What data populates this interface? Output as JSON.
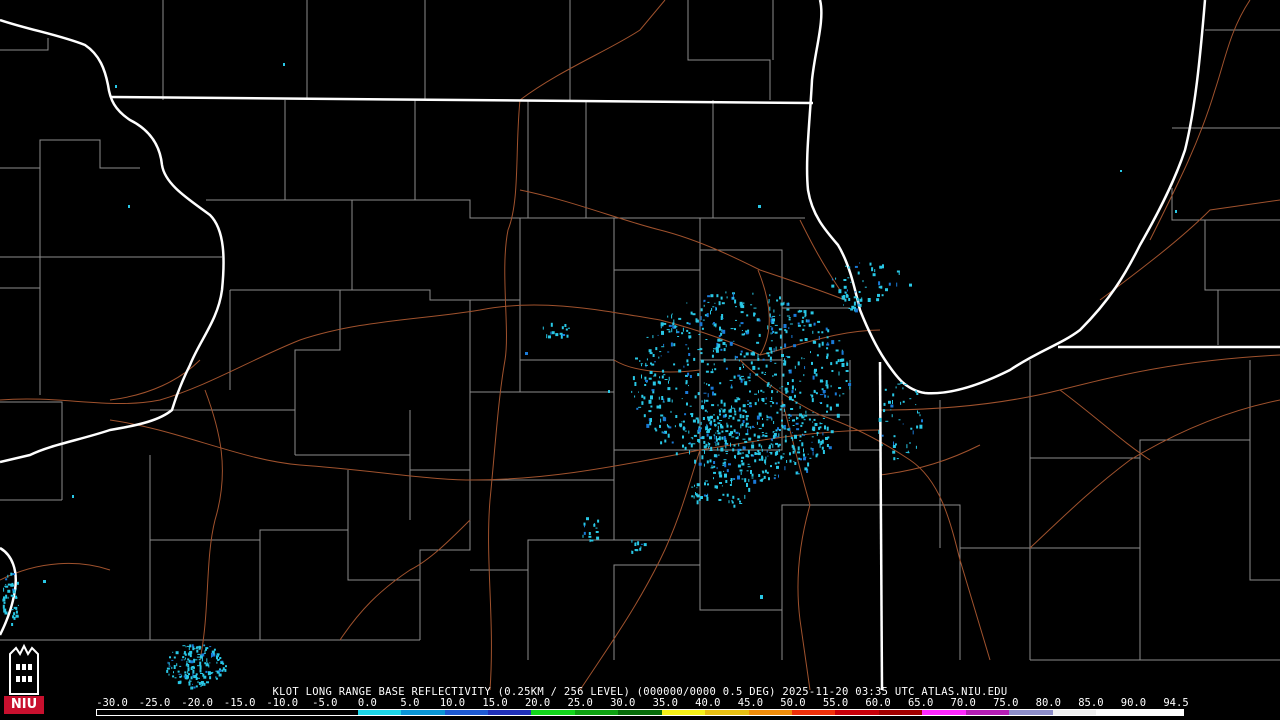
{
  "title": "KLOT LONG RANGE BASE REFLECTIVITY (0.25KM / 256 LEVEL) (000000/0000 0.5 DEG) 2025-11-20 03:35 UTC  ATLAS.NIU.EDU",
  "logo": {
    "text": "NIU",
    "icon": "niu-tower-logo-icon",
    "color": "#c8102e"
  },
  "colorscale": {
    "ticks": [
      "-30.0",
      "-25.0",
      "-20.0",
      "-15.0",
      "-10.0",
      "-5.0",
      "0.0",
      "5.0",
      "10.0",
      "15.0",
      "20.0",
      "25.0",
      "30.0",
      "35.0",
      "40.0",
      "45.0",
      "50.0",
      "55.0",
      "60.0",
      "65.0",
      "70.0",
      "75.0",
      "80.0",
      "85.0",
      "90.0",
      "94.5"
    ],
    "colors": [
      "#000000",
      "#000000",
      "#000000",
      "#000000",
      "#000000",
      "#000000",
      "#1dd6e6",
      "#0a96d6",
      "#1e5ad2",
      "#2030b8",
      "#13d61b",
      "#0ea111",
      "#076c09",
      "#f5f019",
      "#e6be12",
      "#f08c0a",
      "#f0300a",
      "#c8000a",
      "#a00000",
      "#ff28ff",
      "#b41eb4",
      "#8c8cc8",
      "#f0f0f0",
      "#ffffff",
      "#ffffff"
    ]
  },
  "map_colors": {
    "state_border": "#ffffff",
    "county_border": "#8c8c8c",
    "highway": "#a0522d",
    "echo": "#29c8e6",
    "echo_dark": "#1a7ad8"
  }
}
